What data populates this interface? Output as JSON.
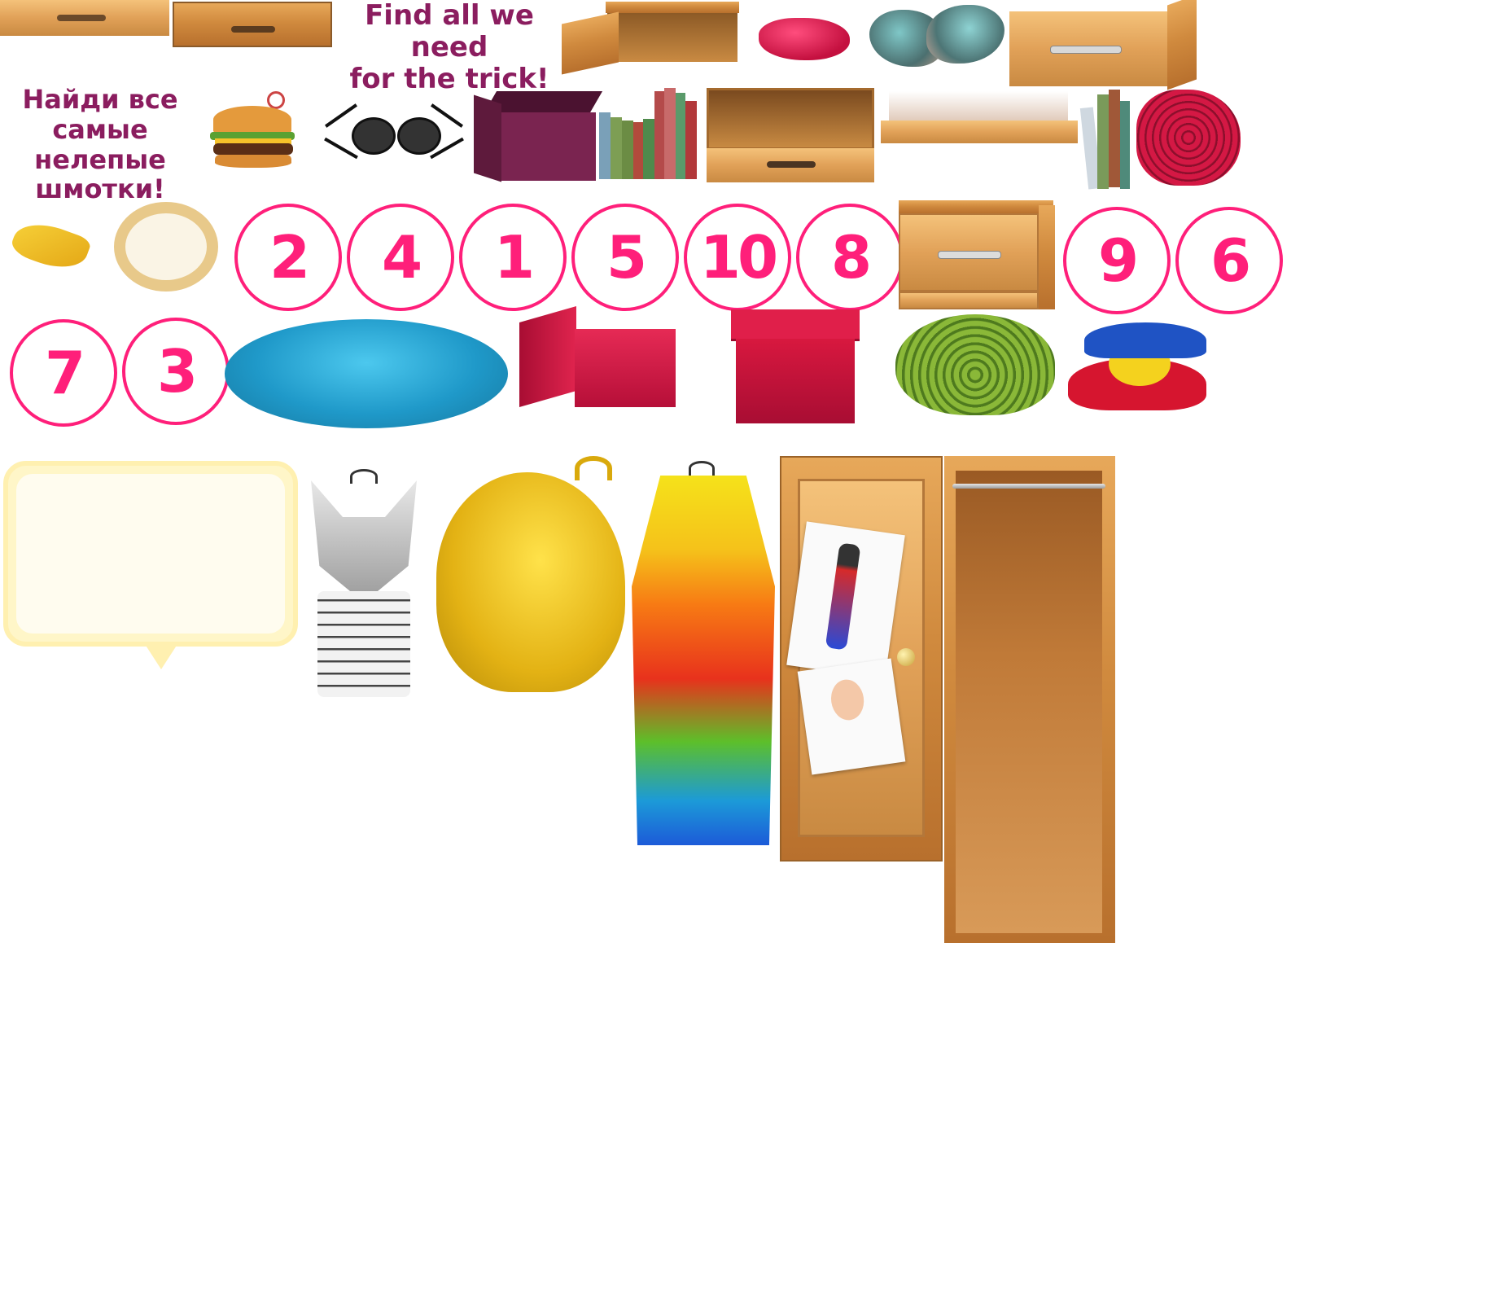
{
  "texts": {
    "english_prompt_line1": "Find all we need",
    "english_prompt_line2": "for the trick!",
    "russian_prompt_line1": "Найди все",
    "russian_prompt_line2": "самые нелепые",
    "russian_prompt_line3": "шмотки!"
  },
  "number_badges": [
    "2",
    "4",
    "1",
    "5",
    "10",
    "8",
    "9",
    "6",
    "7",
    "3"
  ],
  "colors": {
    "title": "#8b1d5f",
    "badge": "#ff1f7a",
    "wood": "#d08a3e",
    "box_red": "#d4123f",
    "box_purple": "#6e1f45",
    "rug": "#27a9d8",
    "speech_bubble": "#fffbe6"
  },
  "sprite_names": [
    "drawer-front",
    "drawer-open",
    "drawer-empty",
    "red-scarf",
    "sequin-shoes",
    "drawer-with-handle",
    "burger-keychain",
    "spider-glasses",
    "purple-box",
    "book-row",
    "open-drawer-large",
    "wooden-shelf",
    "books-stack",
    "red-knit-hat",
    "banana-peel",
    "straw-hat",
    "dresser",
    "blue-rug",
    "red-box-open",
    "red-box-closed",
    "green-scale-hat",
    "eye-pillow-hat",
    "speech-bubble",
    "fox-sweater",
    "yellow-beanbag",
    "rainbow-wig",
    "wardrobe-door",
    "wardrobe-interior"
  ]
}
